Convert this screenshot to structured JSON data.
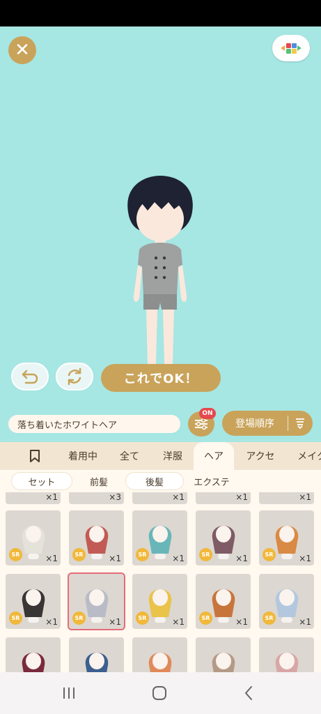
{
  "outfit_name": "落ち着いたホワイトヘア",
  "ok_label": "これでOK！",
  "filter_badge": "ON",
  "sort_label": "登場順序",
  "tabs": [
    "着用中",
    "全て",
    "洋服",
    "ヘア",
    "アクセ",
    "メイク"
  ],
  "subtabs": [
    "セット",
    "前髪",
    "後髪",
    "エクステ"
  ],
  "top_row_counts": [
    "×1",
    "×3",
    "×1",
    "×1",
    "×1"
  ],
  "items": [
    {
      "rarity": "SR",
      "count": "×1",
      "hair": "#e5e2da"
    },
    {
      "rarity": "SR",
      "count": "×1",
      "hair": "#c25b55"
    },
    {
      "rarity": "SR",
      "count": "×1",
      "hair": "#69b6b9"
    },
    {
      "rarity": "SR",
      "count": "×1",
      "hair": "#7e5b65"
    },
    {
      "rarity": "SR",
      "count": "×1",
      "hair": "#d98a45"
    },
    {
      "rarity": "SR",
      "count": "×1",
      "hair": "#3a3535"
    },
    {
      "rarity": "SR",
      "count": "×1",
      "hair": "#b9bcc7"
    },
    {
      "rarity": "SR",
      "count": "×1",
      "hair": "#e9c34a"
    },
    {
      "rarity": "SR",
      "count": "×1",
      "hair": "#c8753c"
    },
    {
      "rarity": "SR",
      "count": "×1",
      "hair": "#b3c8de"
    }
  ],
  "colors": {
    "accent": "#c9a35a",
    "stage": "#a6e6e3",
    "badge": "#e5484d"
  }
}
